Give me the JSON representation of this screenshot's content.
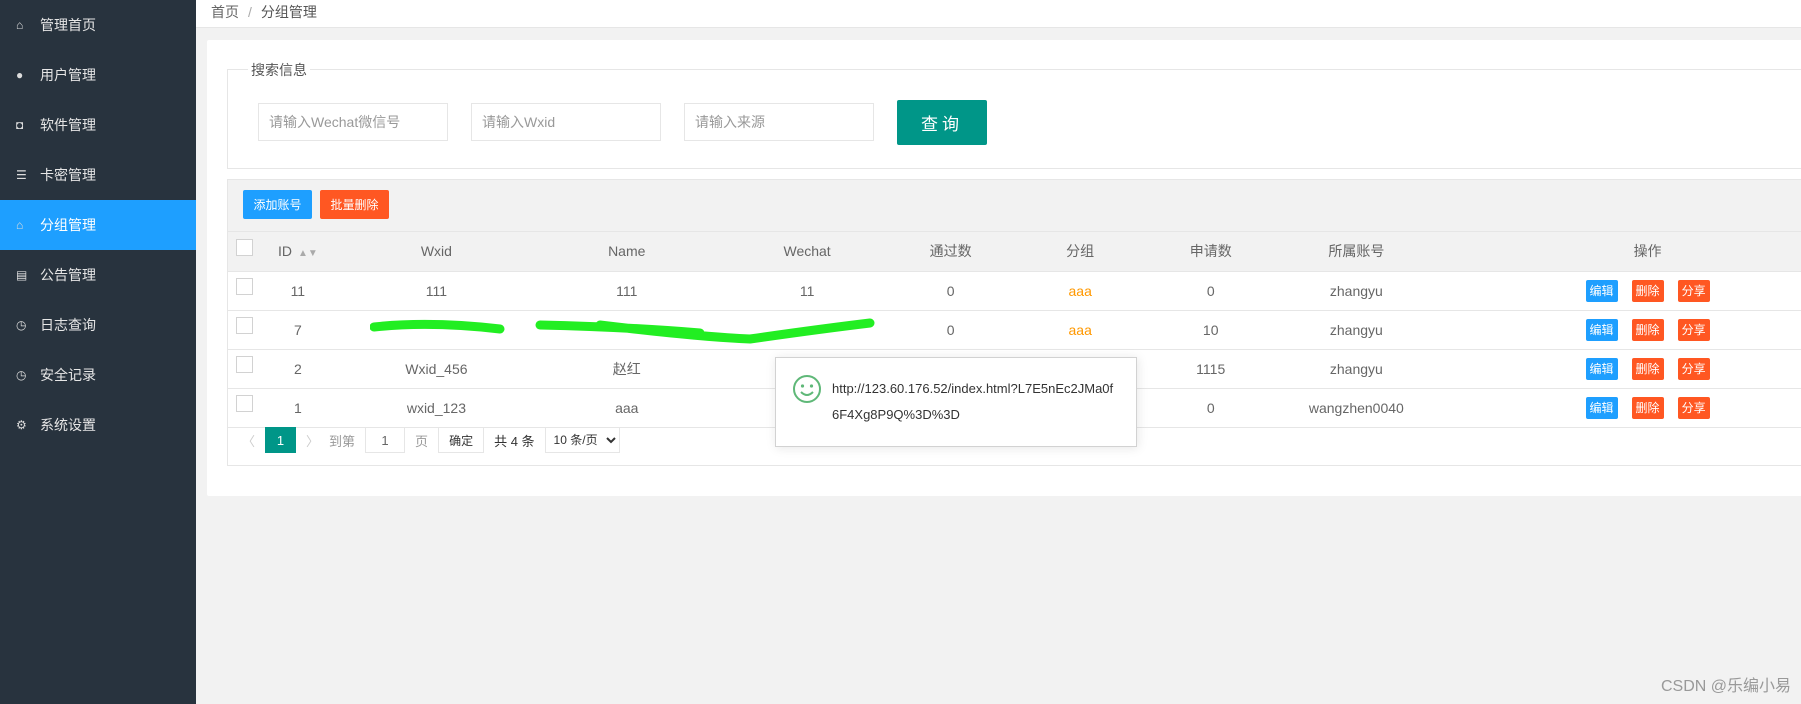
{
  "sidebar": {
    "items": [
      {
        "label": "管理首页",
        "icon": "home-icon",
        "glyph": "⌂"
      },
      {
        "label": "用户管理",
        "icon": "user-icon",
        "glyph": "●"
      },
      {
        "label": "软件管理",
        "icon": "shield-icon",
        "glyph": "◘"
      },
      {
        "label": "卡密管理",
        "icon": "list-icon",
        "glyph": "☰"
      },
      {
        "label": "分组管理",
        "icon": "home-icon",
        "glyph": "⌂",
        "active": true
      },
      {
        "label": "公告管理",
        "icon": "document-icon",
        "glyph": "▤"
      },
      {
        "label": "日志查询",
        "icon": "clock-icon",
        "glyph": "◷"
      },
      {
        "label": "安全记录",
        "icon": "clock-icon",
        "glyph": "◷"
      },
      {
        "label": "系统设置",
        "icon": "gears-icon",
        "glyph": "⚙"
      }
    ]
  },
  "breadcrumb": {
    "home": "首页",
    "sep": "/",
    "current": "分组管理"
  },
  "search": {
    "legend": "搜索信息",
    "wechat_placeholder": "请输入Wechat微信号",
    "wxid_placeholder": "请输入Wxid",
    "source_placeholder": "请输入来源",
    "query_label": "查询"
  },
  "toolbar": {
    "add_label": "添加账号",
    "batch_delete_label": "批量删除"
  },
  "colors": {
    "primary": "#009688",
    "blue": "#1e9fff",
    "red": "#ff5722",
    "sidebar": "#28333e",
    "group_text": "#ff9800"
  },
  "table": {
    "headers": [
      "ID",
      "Wxid",
      "Name",
      "Wechat",
      "通过数",
      "分组",
      "申请数",
      "所属账号",
      "操作"
    ],
    "actions": {
      "edit": "编辑",
      "delete": "删除",
      "share": "分享"
    },
    "rows": [
      {
        "id": "11",
        "wxid": "111",
        "name": "111",
        "wechat": "11",
        "passed": "0",
        "group": "aaa",
        "applied": "0",
        "account": "zhangyu"
      },
      {
        "id": "7",
        "wxid": "",
        "name": "",
        "wechat": "",
        "passed": "0",
        "group": "aaa",
        "applied": "10",
        "account": "zhangyu",
        "redacted": true
      },
      {
        "id": "2",
        "wxid": "Wxid_456",
        "name": "赵红",
        "wechat": "",
        "passed": "",
        "group": "",
        "applied": "1115",
        "account": "zhangyu"
      },
      {
        "id": "1",
        "wxid": "wxid_123",
        "name": "aaa",
        "wechat": "",
        "passed": "",
        "group": "",
        "applied": "0",
        "account": "wangzhen0040"
      }
    ]
  },
  "pager": {
    "current": "1",
    "goto_label": "到第",
    "page_value": "1",
    "page_label": "页",
    "confirm_label": "确定",
    "total_label": "共 4 条",
    "per_page": "10 条/页"
  },
  "popup": {
    "text": "http://123.60.176.52/index.html?L7E5nEc2JMa0f6F4Xg8P9Q%3D%3D",
    "icon": "smile-icon"
  },
  "watermark": "CSDN @乐编小易"
}
